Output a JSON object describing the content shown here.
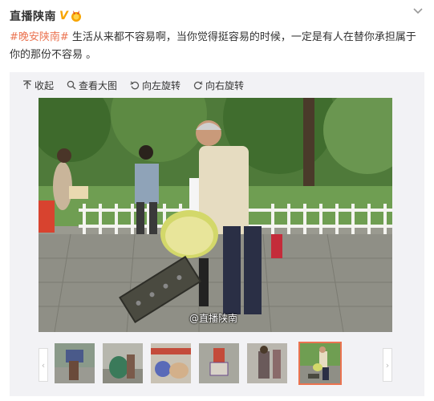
{
  "post": {
    "username": "直播陕南",
    "verified_badge": "V",
    "hashtag": "#晚安陕南#",
    "text": " 生活从来都不容易啊，当你觉得挺容易的时候，一定是有人在替你承担属于你的那份不容易 。"
  },
  "toolbar": {
    "collapse": "收起",
    "view_large": "查看大图",
    "rotate_left": "向左旋转",
    "rotate_right": "向右旋转"
  },
  "photo": {
    "watermark": "@直播陕南"
  },
  "thumbnails": {
    "count": 6,
    "selected_index": 5
  },
  "colors": {
    "hashtag": "#eb7350",
    "verified": "#f7a400",
    "selected_outline": "#eb7350",
    "panel_bg": "#f2f2f5"
  }
}
